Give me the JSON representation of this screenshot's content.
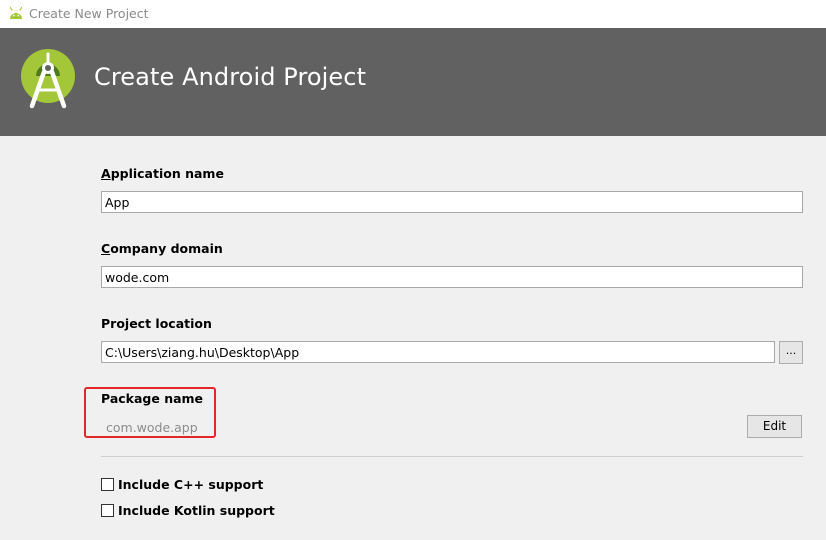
{
  "window": {
    "title": "Create New Project"
  },
  "banner": {
    "heading": "Create Android Project"
  },
  "form": {
    "application_name": {
      "label_key": "A",
      "label_rest": "pplication name",
      "value": "App"
    },
    "company_domain": {
      "label_key": "C",
      "label_rest": "ompany domain",
      "value": "wode.com"
    },
    "project_location": {
      "label": "Project location",
      "value": "C:\\Users\\ziang.hu\\Desktop\\App",
      "browse_label": "..."
    },
    "package_name": {
      "label": "Package name",
      "value": "com.wode.app",
      "edit_label": "Edit"
    }
  },
  "options": {
    "cpp_support": {
      "label": "Include C++ support",
      "checked": false
    },
    "kotlin_support": {
      "label": "Include Kotlin support",
      "checked": false
    }
  },
  "colors": {
    "banner_bg": "#616161",
    "android_green": "#a4c639",
    "highlight_red": "#e3262a"
  }
}
